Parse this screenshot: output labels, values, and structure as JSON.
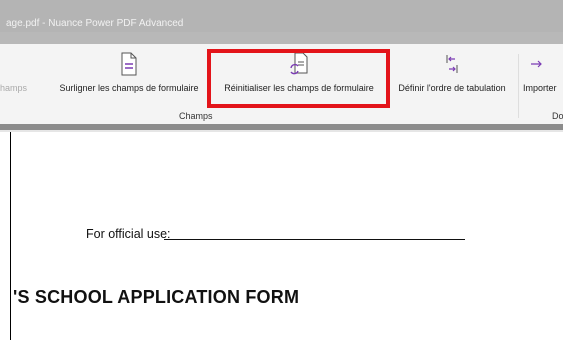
{
  "window": {
    "title": "age.pdf - Nuance Power PDF Advanced"
  },
  "ribbon": {
    "buttons": {
      "champs_partial": "hamps",
      "highlight_fields": "Surligner les champs de formulaire",
      "reset_fields": "Réinitialiser les champs de formulaire",
      "tab_order": "Définir l'ordre de tabulation",
      "import": "Importer"
    },
    "groups": {
      "champs": "Champs",
      "next_partial": "Do"
    }
  },
  "document": {
    "official_use_label": "For official use:",
    "form_title": "'S SCHOOL APPLICATION FORM"
  },
  "colors": {
    "highlight_border": "#e3141a",
    "icon_accent": "#7a3bb3"
  }
}
